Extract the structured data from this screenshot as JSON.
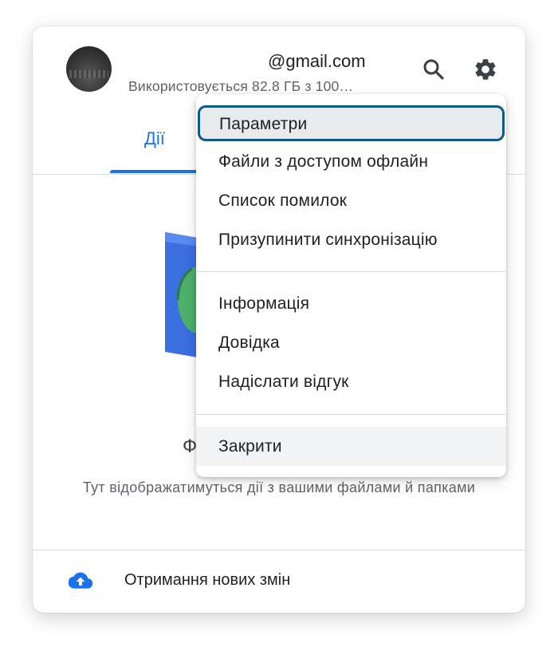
{
  "account": {
    "email": "@gmail.com",
    "usage": "Використовується 82.8 ГБ з 100…"
  },
  "tabs": [
    {
      "label": "Дії",
      "active": true
    }
  ],
  "empty_state": {
    "title_visible": "Ф",
    "description": "Тут відображатимуться дії з вашими файлами й папками"
  },
  "footer": {
    "sync_label": "Отримання нових змін",
    "sync_icon": "cloud-upload-icon"
  },
  "menu": {
    "items": [
      {
        "label": "Параметри",
        "state": "focused"
      },
      {
        "label": "Файли з доступом офлайн"
      },
      {
        "label": "Список помилок"
      },
      {
        "label": "Призупинити синхронізацію"
      },
      {
        "label": "Інформація"
      },
      {
        "label": "Довідка"
      },
      {
        "label": "Надіслати відгук"
      },
      {
        "label": "Закрити",
        "state": "hovered"
      }
    ]
  },
  "colors": {
    "accent": "#1a73e8",
    "focus_ring": "#0e5a8a",
    "text_primary": "#202124",
    "text_secondary": "#5f6368",
    "divider": "#dadce0"
  }
}
